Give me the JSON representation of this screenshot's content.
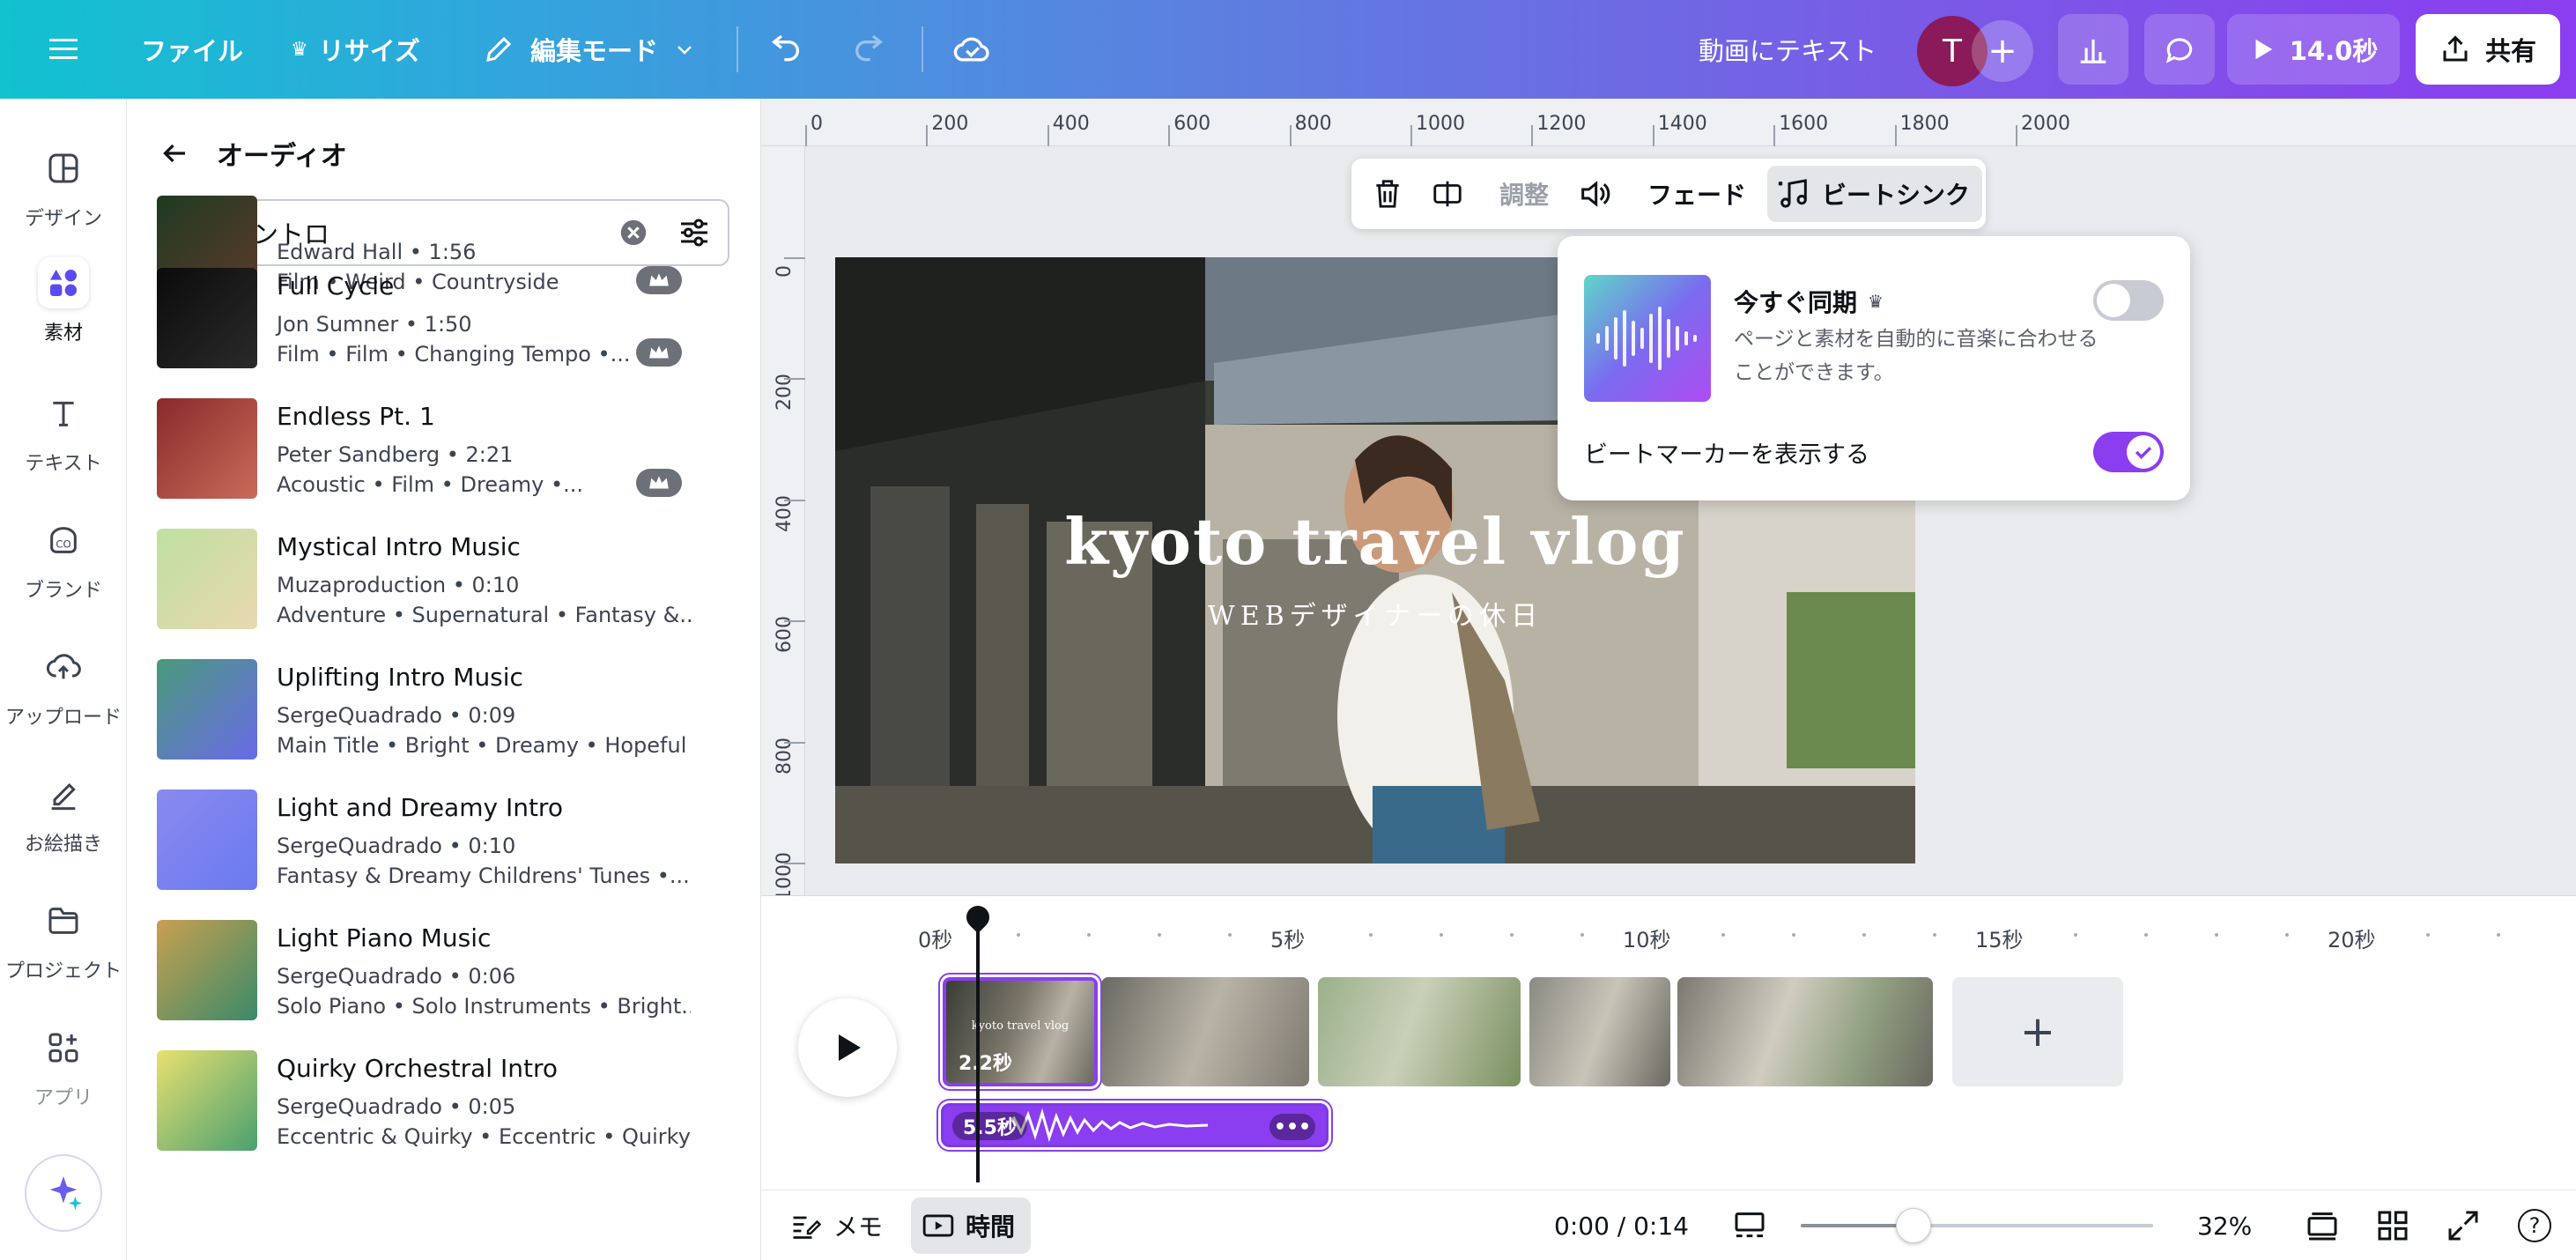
{
  "topbar": {
    "file": "ファイル",
    "resize": "リサイズ",
    "edit_mode": "編集モード",
    "video_text": "動画にテキスト",
    "avatar_letter": "T",
    "duration": "14.0秒",
    "share": "共有"
  },
  "rail": {
    "items": [
      {
        "label": "デザイン",
        "icon": "layout-icon"
      },
      {
        "label": "素材",
        "icon": "elements-icon"
      },
      {
        "label": "テキスト",
        "icon": "text-icon"
      },
      {
        "label": "ブランド",
        "icon": "brand-icon"
      },
      {
        "label": "アップロード",
        "icon": "upload-cloud-icon"
      },
      {
        "label": "お絵描き",
        "icon": "draw-icon"
      },
      {
        "label": "プロジェクト",
        "icon": "folder-icon"
      },
      {
        "label": "アプリ",
        "icon": "apps-icon"
      }
    ]
  },
  "panel": {
    "title": "オーディオ",
    "search_value": "イントロ",
    "tracks": [
      {
        "title": "",
        "meta": "Edward Hall • 1:56",
        "tags": "Film • Weird • Countryside",
        "premium": true,
        "color1": "#1f3a22",
        "color2": "#5c3a2a"
      },
      {
        "title": "Full Cycle",
        "meta": "Jon Sumner • 1:50",
        "tags": "Film • Film • Changing Tempo •...",
        "premium": true,
        "color1": "#0b0b0b",
        "color2": "#2a2a2a"
      },
      {
        "title": "Endless Pt. 1",
        "meta": "Peter Sandberg • 2:21",
        "tags": "Acoustic • Film • Dreamy •...",
        "premium": true,
        "color1": "#8a2a2a",
        "color2": "#c96b5a"
      },
      {
        "title": "Mystical Intro Music",
        "meta": "Muzaproduction • 0:10",
        "tags": "Adventure • Supernatural • Fantasy &...",
        "premium": false,
        "color1": "#bfe0a0",
        "color2": "#e8d8b0"
      },
      {
        "title": "Uplifting Intro Music",
        "meta": "SergeQuadrado • 0:09",
        "tags": "Main Title • Bright • Dreamy • Hopeful ...",
        "premium": false,
        "color1": "#4a9a7a",
        "color2": "#6a6ae8"
      },
      {
        "title": "Light and Dreamy Intro",
        "meta": "SergeQuadrado • 0:10",
        "tags": "Fantasy & Dreamy Childrens' Tunes •...",
        "premium": false,
        "color1": "#8a8aee",
        "color2": "#6a7af0"
      },
      {
        "title": "Light Piano Music",
        "meta": "SergeQuadrado • 0:06",
        "tags": "Solo Piano • Solo Instruments • Bright...",
        "premium": false,
        "color1": "#c9a050",
        "color2": "#3a8a6a"
      },
      {
        "title": "Quirky Orchestral Intro",
        "meta": "SergeQuadrado • 0:05",
        "tags": "Eccentric & Quirky • Eccentric • Quirky",
        "premium": false,
        "color1": "#e8e070",
        "color2": "#4aa070"
      }
    ]
  },
  "ruler": {
    "top": [
      "0",
      "200",
      "400",
      "600",
      "800",
      "1000",
      "1200",
      "1400",
      "1600",
      "1800",
      "2000"
    ],
    "left": [
      "0",
      "200",
      "400",
      "600",
      "800",
      "1000"
    ]
  },
  "video": {
    "title": "kyoto travel vlog",
    "subtitle": "WEBデザイナーの休日"
  },
  "context_toolbar": {
    "adjust": "調整",
    "fade": "フェード",
    "beat_sync": "ビートシンク"
  },
  "beat_popover": {
    "title": "今すぐ同期",
    "description": "ページと素材を自動的に音楽に合わせることができます。",
    "show_markers": "ビートマーカーを表示する",
    "sync_now_on": false,
    "show_markers_on": true
  },
  "timeline": {
    "labels": [
      "0秒",
      "5秒",
      "10秒",
      "15秒",
      "20秒"
    ],
    "first_clip_duration": "2.2秒",
    "first_clip_title": "kyoto travel vlog",
    "audio_duration": "5.5秒",
    "add_symbol": "+"
  },
  "footer": {
    "notes": "メモ",
    "timing": "時間",
    "time": "0:00 / 0:14",
    "zoom": "32%",
    "zoom_value": 0.32,
    "help": "?"
  },
  "colors": {
    "accent": "#8b3df0",
    "toggle_on": "#8b3df0",
    "toggle_off": "#c7cbd3"
  }
}
